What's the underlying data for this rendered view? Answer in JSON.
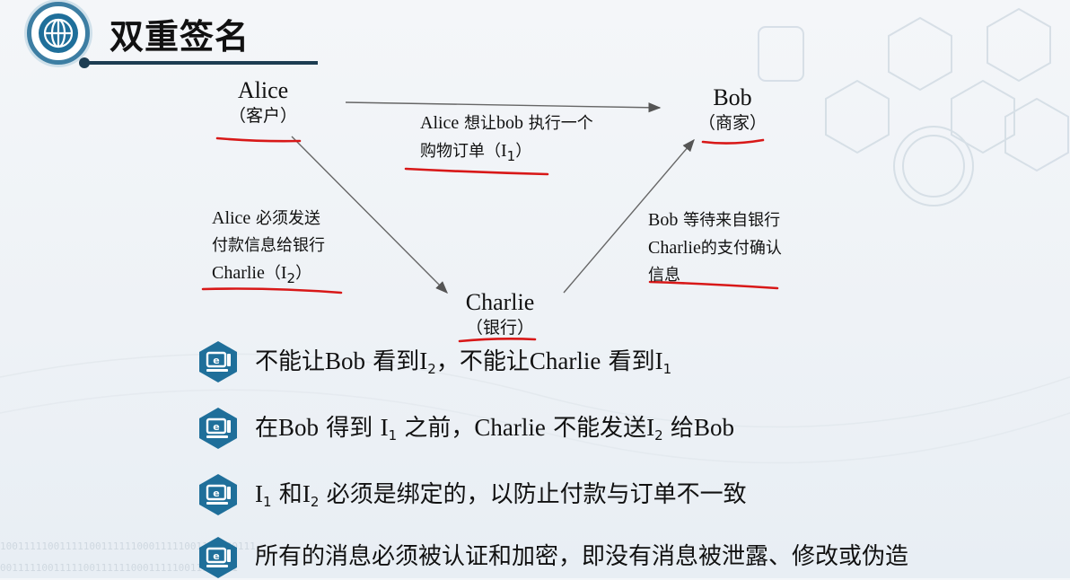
{
  "title": "双重签名",
  "nodes": {
    "alice": {
      "name": "Alice",
      "role": "（客户）"
    },
    "bob": {
      "name": "Bob",
      "role": "（商家）"
    },
    "charlie": {
      "name": "Charlie",
      "role": "（银行）"
    }
  },
  "notes": {
    "alice_to_bob": {
      "line1_latin": "Alice",
      "line1_rest": " 想让",
      "line1_latin2": "bob",
      "line1_tail": " 执行一个",
      "line2": "购物订单（",
      "line2_i": "I",
      "line2_sub": "1",
      "line2_end": "）"
    },
    "alice_to_charlie": {
      "line1_latin": "Alice",
      "line1_rest": " 必须发送",
      "line2": "付款信息给银行",
      "line3_latin": "Charlie",
      "line3_rest": "（",
      "line3_i": "I",
      "line3_sub": "2",
      "line3_end": "）"
    },
    "charlie_to_bob": {
      "line1_latin": "Bob",
      "line1_rest": " 等待来自银行",
      "line2_latin": "Charlie",
      "line2_rest": "的支付确认",
      "line3": "信息"
    }
  },
  "bullets": [
    {
      "parts": [
        "不能让",
        "Bob",
        " 看到",
        "I",
        "2",
        "，不能让",
        "Charlie",
        " 看到",
        "I",
        "1"
      ]
    },
    {
      "parts": [
        "在",
        "Bob",
        " 得到 ",
        "I",
        "1",
        " 之前，",
        "Charlie",
        " 不能发送",
        "I",
        "2",
        " 给",
        "Bob"
      ]
    },
    {
      "parts": [
        "I",
        "1",
        " 和",
        "I",
        "2",
        " 必须是绑定的，以防止付款与订单不一致"
      ]
    },
    {
      "parts": [
        "所有的消息必须被认证和加密，即没有消息被泄露、修改或伪造"
      ]
    }
  ],
  "colors": {
    "annotation_red": "#d81818",
    "icon_blue": "#1f6f9a",
    "title_dark": "#1d3d52"
  },
  "icons": [
    "globe-icon",
    "computer-icon"
  ]
}
